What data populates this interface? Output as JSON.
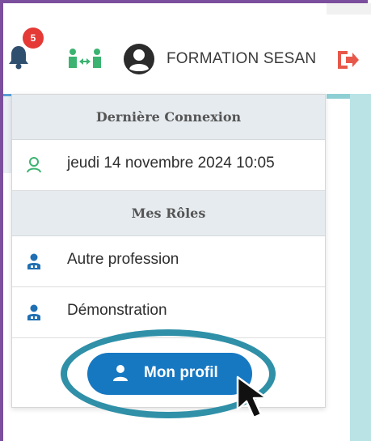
{
  "header": {
    "notification_count": "5",
    "username": "FORMATION SESAN",
    "icons": {
      "bell": "bell-icon",
      "switch": "switch-users-icon",
      "avatar": "user-circle-icon",
      "logout": "logout-icon"
    }
  },
  "dropdown": {
    "last_login": {
      "header": "Dernière Connexion",
      "value": "jeudi 14 novembre 2024 10:05",
      "icon": "user-outline-icon"
    },
    "roles": {
      "header": "Mes Rôles",
      "items": [
        {
          "label": "Autre profession",
          "icon": "user-role-icon"
        },
        {
          "label": "Démonstration",
          "icon": "user-role-icon"
        }
      ]
    },
    "profile_button": {
      "label": "Mon profil",
      "icon": "user-icon"
    }
  },
  "colors": {
    "frame": "#7b4f9d",
    "badge": "#e53935",
    "switch_icon": "#3cb371",
    "logout_icon": "#e8584a",
    "primary_button": "#1778c2",
    "highlight_ring": "#2f90a8"
  }
}
